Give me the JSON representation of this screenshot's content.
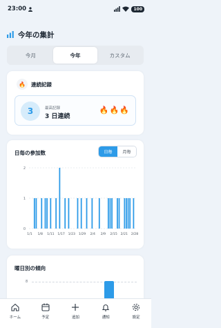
{
  "status_bar": {
    "time": "23:00",
    "battery": "100"
  },
  "header": {
    "title": "今年の集計"
  },
  "tabs": [
    {
      "label": "今月",
      "active": false
    },
    {
      "label": "今年",
      "active": true
    },
    {
      "label": "カスタム",
      "active": false
    }
  ],
  "streak": {
    "title": "連続記録",
    "current": "3",
    "best_label": "最高記録",
    "best_value": "3 日連続",
    "flame_count": 3
  },
  "daily_chart": {
    "title": "日毎の参加数",
    "toggle": {
      "daily": "日毎",
      "monthly": "月毎",
      "selected": "daily"
    }
  },
  "chart_data": {
    "type": "bar",
    "title": "日毎の参加数",
    "x_tick_labels": [
      "1/1",
      "1/8",
      "1/11",
      "1/17",
      "1/23",
      "1/29",
      "2/4",
      "2/9",
      "2/15",
      "2/21",
      "2/28"
    ],
    "ylim": [
      0,
      2
    ],
    "y_ticks": [
      "0",
      "1",
      "2"
    ],
    "days_with_participation": [
      {
        "day_of_year": 4,
        "value": 1
      },
      {
        "day_of_year": 5,
        "value": 1
      },
      {
        "day_of_year": 8,
        "value": 1
      },
      {
        "day_of_year": 10,
        "value": 1
      },
      {
        "day_of_year": 11,
        "value": 1
      },
      {
        "day_of_year": 13,
        "value": 1
      },
      {
        "day_of_year": 16,
        "value": 1
      },
      {
        "day_of_year": 18,
        "value": 2
      },
      {
        "day_of_year": 21,
        "value": 1
      },
      {
        "day_of_year": 23,
        "value": 1
      },
      {
        "day_of_year": 28,
        "value": 1
      },
      {
        "day_of_year": 30,
        "value": 1
      },
      {
        "day_of_year": 33,
        "value": 1
      },
      {
        "day_of_year": 36,
        "value": 1
      },
      {
        "day_of_year": 40,
        "value": 1
      },
      {
        "day_of_year": 45,
        "value": 1
      },
      {
        "day_of_year": 46,
        "value": 1
      },
      {
        "day_of_year": 47,
        "value": 1
      },
      {
        "day_of_year": 50,
        "value": 1
      },
      {
        "day_of_year": 51,
        "value": 1
      },
      {
        "day_of_year": 54,
        "value": 1
      },
      {
        "day_of_year": 55,
        "value": 1
      },
      {
        "day_of_year": 56,
        "value": 1
      },
      {
        "day_of_year": 57,
        "value": 1
      },
      {
        "day_of_year": 59,
        "value": 1
      }
    ],
    "x_range": [
      1,
      60
    ],
    "bar_color": "#2d9be8",
    "grid": true
  },
  "weekday_chart": {
    "title": "曜日別の傾向",
    "y_tick": "8"
  },
  "bottom_nav": [
    {
      "label": "ホーム",
      "icon": "home-icon"
    },
    {
      "label": "予定",
      "icon": "calendar-icon"
    },
    {
      "label": "追加",
      "icon": "plus-icon"
    },
    {
      "label": "通知",
      "icon": "bell-icon"
    },
    {
      "label": "設定",
      "icon": "gear-icon"
    }
  ],
  "colors": {
    "accent": "#2d9be8",
    "background": "#eef3f9"
  }
}
